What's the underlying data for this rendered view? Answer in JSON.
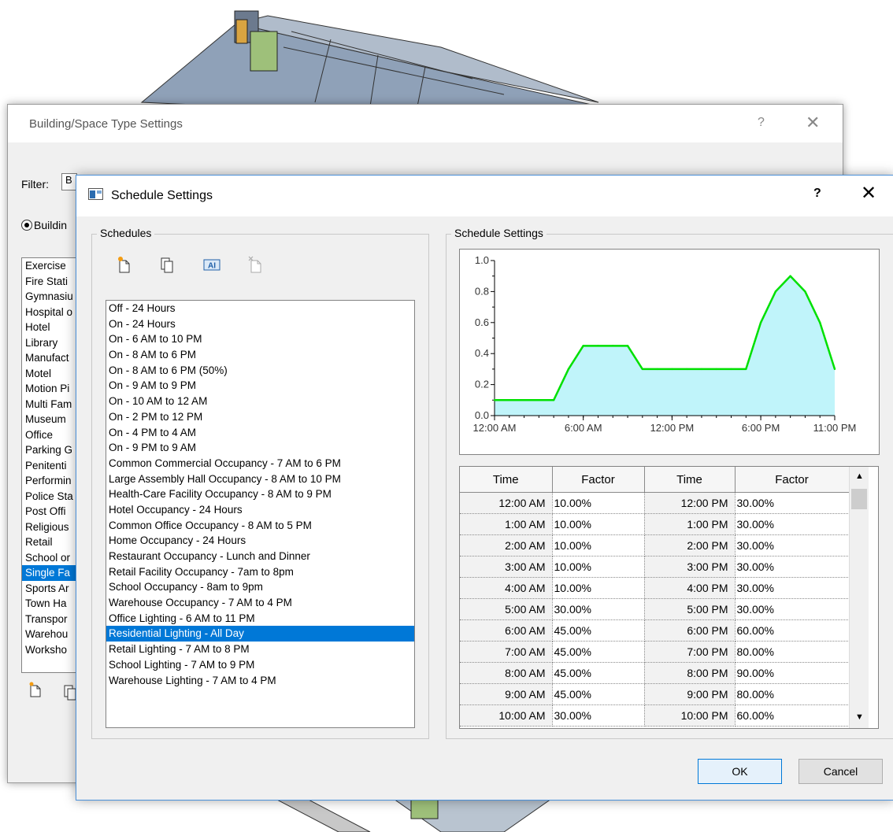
{
  "back_dialog": {
    "title": "Building/Space Type Settings",
    "help": "?",
    "close": "✕",
    "filter_label": "Filter:",
    "filter_value": "B",
    "radio_label": "Buildin",
    "list_items": [
      {
        "label": "Exercise",
        "selected": false
      },
      {
        "label": "Fire Stati",
        "selected": false
      },
      {
        "label": "Gymnasiu",
        "selected": false
      },
      {
        "label": "Hospital o",
        "selected": false
      },
      {
        "label": "Hotel",
        "selected": false
      },
      {
        "label": "Library",
        "selected": false
      },
      {
        "label": "Manufact",
        "selected": false
      },
      {
        "label": "Motel",
        "selected": false
      },
      {
        "label": "Motion Pi",
        "selected": false
      },
      {
        "label": "Multi Fam",
        "selected": false
      },
      {
        "label": "Museum",
        "selected": false
      },
      {
        "label": "Office",
        "selected": false
      },
      {
        "label": "Parking G",
        "selected": false
      },
      {
        "label": "Penitenti",
        "selected": false
      },
      {
        "label": "Performin",
        "selected": false
      },
      {
        "label": "Police Sta",
        "selected": false
      },
      {
        "label": "Post Offi",
        "selected": false
      },
      {
        "label": "Religious",
        "selected": false
      },
      {
        "label": "Retail",
        "selected": false
      },
      {
        "label": "School or",
        "selected": false
      },
      {
        "label": "Single Fa",
        "selected": true
      },
      {
        "label": "Sports Ar",
        "selected": false
      },
      {
        "label": "Town Ha",
        "selected": false
      },
      {
        "label": "Transpor",
        "selected": false
      },
      {
        "label": "Warehou",
        "selected": false
      },
      {
        "label": "Worksho",
        "selected": false
      }
    ]
  },
  "front_dialog": {
    "title": "Schedule Settings",
    "help": "?",
    "close": "✕",
    "schedules_group_label": "Schedules",
    "settings_group_label": "Schedule Settings",
    "schedules": [
      {
        "label": "Off - 24 Hours",
        "selected": false
      },
      {
        "label": "On - 24 Hours",
        "selected": false
      },
      {
        "label": "On - 6 AM to 10 PM",
        "selected": false
      },
      {
        "label": "On - 8 AM to 6 PM",
        "selected": false
      },
      {
        "label": "On - 8 AM to 6 PM (50%)",
        "selected": false
      },
      {
        "label": "On - 9 AM to 9 PM",
        "selected": false
      },
      {
        "label": "On - 10 AM to 12 AM",
        "selected": false
      },
      {
        "label": "On - 2 PM to 12 PM",
        "selected": false
      },
      {
        "label": "On - 4 PM to 4 AM",
        "selected": false
      },
      {
        "label": "On - 9 PM to 9 AM",
        "selected": false
      },
      {
        "label": "Common Commercial Occupancy - 7 AM to 6 PM",
        "selected": false
      },
      {
        "label": "Large Assembly Hall Occupancy - 8 AM to 10 PM",
        "selected": false
      },
      {
        "label": "Health-Care Facility Occupancy - 8 AM to 9 PM",
        "selected": false
      },
      {
        "label": "Hotel Occupancy - 24 Hours",
        "selected": false
      },
      {
        "label": "Common Office Occupancy - 8 AM to 5 PM",
        "selected": false
      },
      {
        "label": "Home Occupancy - 24 Hours",
        "selected": false
      },
      {
        "label": "Restaurant Occupancy - Lunch and Dinner",
        "selected": false
      },
      {
        "label": "Retail Facility Occupancy - 7am to 8pm",
        "selected": false
      },
      {
        "label": "School Occupancy - 8am to 9pm",
        "selected": false
      },
      {
        "label": "Warehouse Occupancy - 7 AM to 4 PM",
        "selected": false
      },
      {
        "label": "Office Lighting - 6 AM to 11 PM",
        "selected": false
      },
      {
        "label": "Residential Lighting - All Day",
        "selected": true
      },
      {
        "label": "Retail Lighting - 7 AM to 8 PM",
        "selected": false
      },
      {
        "label": "School Lighting - 7 AM to 9 PM",
        "selected": false
      },
      {
        "label": "Warehouse Lighting - 7 AM to 4 PM",
        "selected": false
      }
    ],
    "table": {
      "headers": [
        "Time",
        "Factor",
        "Time",
        "Factor"
      ],
      "rows": [
        [
          "12:00 AM",
          "10.00%",
          "12:00 PM",
          "30.00%"
        ],
        [
          "1:00 AM",
          "10.00%",
          "1:00 PM",
          "30.00%"
        ],
        [
          "2:00 AM",
          "10.00%",
          "2:00 PM",
          "30.00%"
        ],
        [
          "3:00 AM",
          "10.00%",
          "3:00 PM",
          "30.00%"
        ],
        [
          "4:00 AM",
          "10.00%",
          "4:00 PM",
          "30.00%"
        ],
        [
          "5:00 AM",
          "30.00%",
          "5:00 PM",
          "30.00%"
        ],
        [
          "6:00 AM",
          "45.00%",
          "6:00 PM",
          "60.00%"
        ],
        [
          "7:00 AM",
          "45.00%",
          "7:00 PM",
          "80.00%"
        ],
        [
          "8:00 AM",
          "45.00%",
          "8:00 PM",
          "90.00%"
        ],
        [
          "9:00 AM",
          "45.00%",
          "9:00 PM",
          "80.00%"
        ],
        [
          "10:00 AM",
          "30.00%",
          "10:00 PM",
          "60.00%"
        ]
      ]
    },
    "ok_label": "OK",
    "cancel_label": "Cancel"
  },
  "chart_data": {
    "type": "area",
    "x": [
      0,
      1,
      2,
      3,
      4,
      5,
      6,
      7,
      8,
      9,
      10,
      11,
      12,
      13,
      14,
      15,
      16,
      17,
      18,
      19,
      20,
      21,
      22,
      23
    ],
    "values": [
      0.1,
      0.1,
      0.1,
      0.1,
      0.1,
      0.3,
      0.45,
      0.45,
      0.45,
      0.45,
      0.3,
      0.3,
      0.3,
      0.3,
      0.3,
      0.3,
      0.3,
      0.3,
      0.6,
      0.8,
      0.9,
      0.8,
      0.6,
      0.3
    ],
    "xtick_labels": [
      "12:00 AM",
      "6:00 AM",
      "12:00 PM",
      "6:00 PM",
      "11:00 PM"
    ],
    "xtick_positions": [
      0,
      6,
      12,
      18,
      23
    ],
    "ytick_labels": [
      "0.0",
      "0.2",
      "0.4",
      "0.6",
      "0.8",
      "1.0"
    ],
    "ylim": [
      0,
      1
    ],
    "xlim": [
      0,
      23
    ],
    "line_color": "#00e000",
    "fill_color": "#c0f4fa"
  }
}
